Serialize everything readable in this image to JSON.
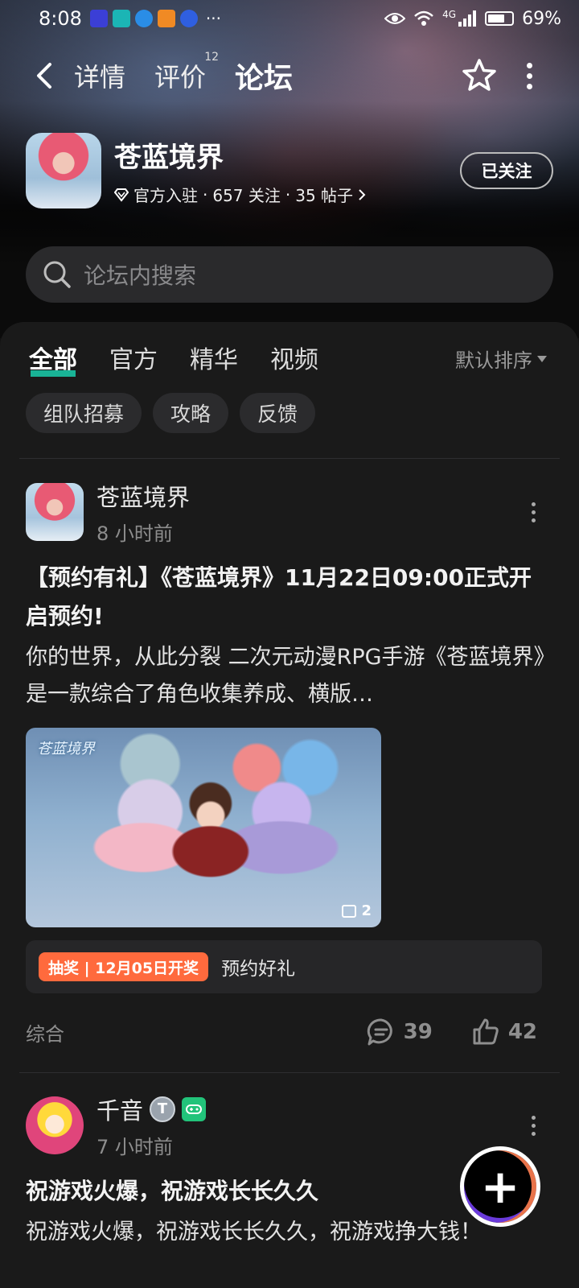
{
  "status": {
    "time": "8:08",
    "notif_icons": [
      "paytm-icon",
      "top-icon",
      "cloud-icon",
      "photo-icon",
      "bulb-icon"
    ],
    "more": "···",
    "network": "4G",
    "battery": "69%"
  },
  "nav": {
    "tabs": [
      {
        "label": "详情"
      },
      {
        "label": "评价",
        "badge": "12"
      },
      {
        "label": "论坛"
      }
    ],
    "active_tab": "论坛"
  },
  "game": {
    "title": "苍蓝境界",
    "official": "官方入驻",
    "followers": "657 关注",
    "posts": "35 帖子",
    "sep": "·",
    "follow_button": "已关注"
  },
  "search": {
    "placeholder": "论坛内搜索"
  },
  "categories": {
    "tabs": [
      "全部",
      "官方",
      "精华",
      "视频"
    ],
    "active": "全部",
    "sort_label": "默认排序"
  },
  "chips": [
    "组队招募",
    "攻略",
    "反馈"
  ],
  "posts": [
    {
      "author": "苍蓝境界",
      "time": "8 小时前",
      "title": "【预约有礼】《苍蓝境界》11月22日09:00正式开启预约!",
      "body": "你的世界，从此分裂 二次元动漫RPG手游《苍蓝境界》是一款综合了角色收集养成、横版…",
      "image_logo": "苍蓝境界",
      "image_count": "2",
      "lottery_tag": "抽奖 | 12月05日开奖",
      "lottery_text": "预约好礼",
      "category": "综合",
      "comments": "39",
      "likes": "42"
    },
    {
      "author": "千音",
      "badge_t": "T",
      "time": "7 小时前",
      "title": "祝游戏火爆，祝游戏长长久久",
      "body": "祝游戏火爆，祝游戏长长久久，祝游戏挣大钱！"
    }
  ],
  "colors": {
    "accent": "#19c4a4",
    "lottery": "#ff6a3d",
    "background": "#1a1a1a"
  }
}
